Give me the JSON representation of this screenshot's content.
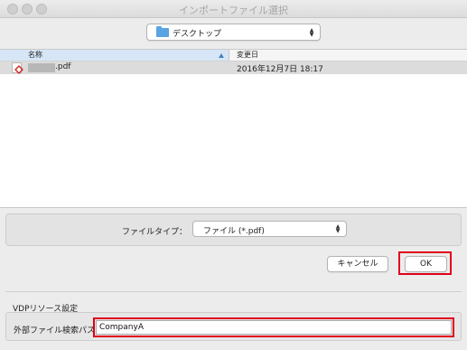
{
  "window": {
    "title": "インポートファイル選択"
  },
  "location": {
    "selected": "デスクトップ"
  },
  "file_list": {
    "columns": {
      "name": "名称",
      "date": "変更日"
    },
    "rows": [
      {
        "name": ".pdf",
        "date": "2016年12月7日 18:17"
      }
    ]
  },
  "file_type": {
    "label": "ファイルタイプ：",
    "selected": "ファイル (*.pdf)"
  },
  "buttons": {
    "cancel": "キャンセル",
    "ok": "OK"
  },
  "vdp": {
    "section_title": "VDPリソース設定",
    "path_label": "外部ファイル検索パス:",
    "path_value": "CompanyA"
  },
  "colors": {
    "highlight_border": "#e0001b",
    "selected_row": "#dcdcdc",
    "header_sorted": "#d6e6f6"
  },
  "icons": [
    "close-icon",
    "minimize-icon",
    "zoom-icon",
    "folder-icon",
    "pdf-file-icon",
    "sort-ascending-icon",
    "select-arrows-icon"
  ]
}
